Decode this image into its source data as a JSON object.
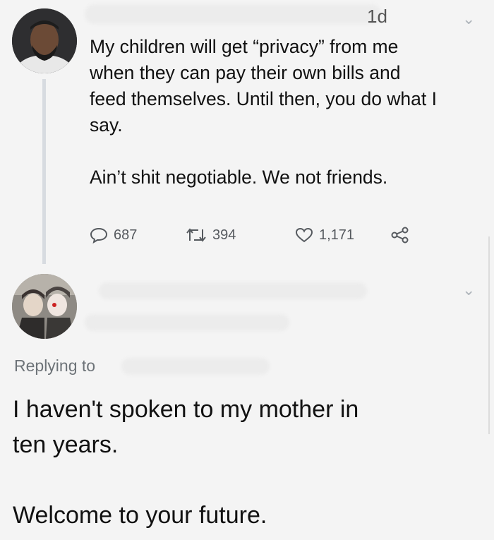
{
  "tweet": {
    "time_fragment": "1d",
    "lines": [
      "My children will get “privacy” from me",
      "when they can pay their own bills and",
      "feed themselves. Until then, you do what I",
      "say."
    ],
    "second_paragraph": "Ain’t shit negotiable. We not friends.",
    "stats": {
      "replies": "687",
      "retweets": "394",
      "likes": "1,171"
    }
  },
  "reply": {
    "replying_to_label": "Replying to",
    "lines": [
      "I haven't spoken to my mother in",
      "ten years."
    ],
    "second_paragraph": "Welcome to your future."
  },
  "icons": {
    "reply": "reply-icon",
    "retweet": "retweet-icon",
    "like": "heart-icon",
    "share": "share-icon",
    "more": "chevron-down-icon"
  },
  "colors": {
    "background": "#f4f4f4",
    "text": "#111111",
    "muted": "#6d7378",
    "thread_line": "#d7dbe0"
  }
}
